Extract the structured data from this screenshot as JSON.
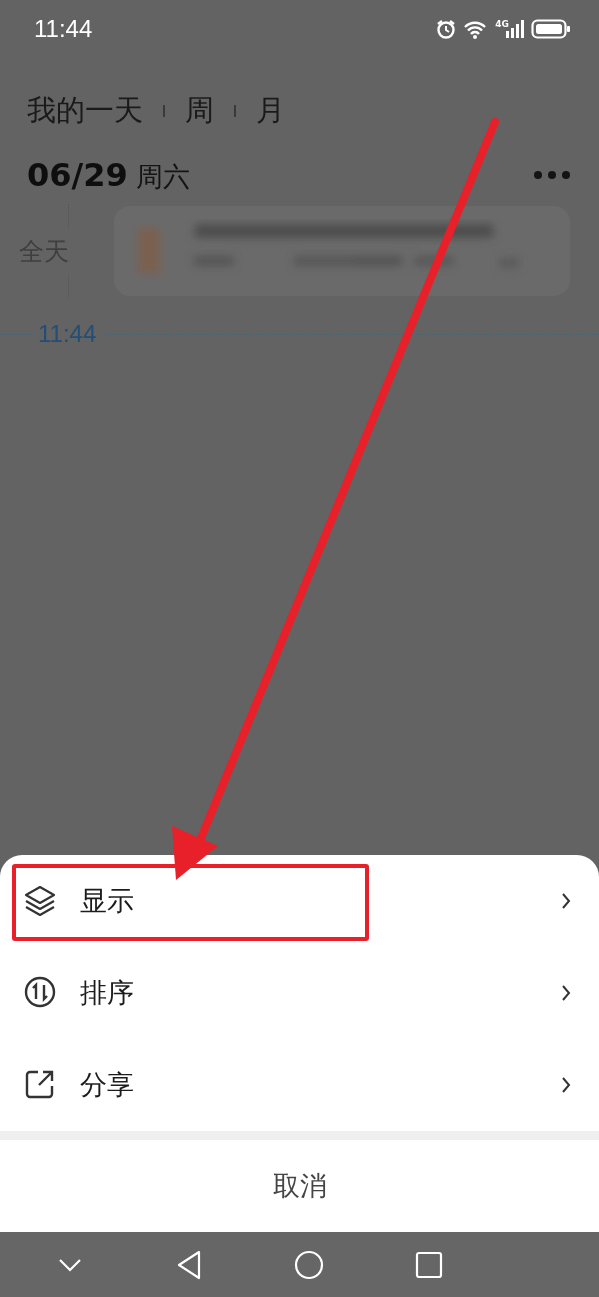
{
  "status_bar": {
    "time": "11:44",
    "network": "4G"
  },
  "view_tabs": [
    {
      "label": "我的一天"
    },
    {
      "label": "周"
    },
    {
      "label": "月"
    }
  ],
  "date_header": {
    "date": "06/29",
    "weekday": "周六"
  },
  "all_day_label": "全天",
  "current_time": "11:44",
  "action_sheet": {
    "items": [
      {
        "label": "显示",
        "kind": "layers"
      },
      {
        "label": "排序",
        "kind": "sort"
      },
      {
        "label": "分享",
        "kind": "share"
      }
    ],
    "cancel": "取消"
  },
  "annotations": {
    "arrow": true,
    "highlight_box": true
  }
}
